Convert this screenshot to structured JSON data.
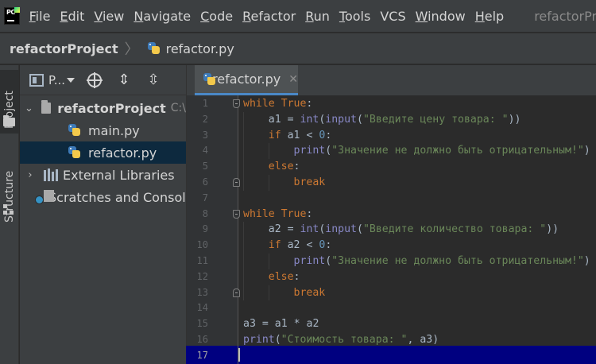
{
  "app": {
    "logo_text": "PC",
    "window_title": "refactorPro"
  },
  "menu": [
    {
      "label": "File",
      "mnemonic": "F",
      "rest": "ile"
    },
    {
      "label": "Edit",
      "mnemonic": "E",
      "rest": "dit"
    },
    {
      "label": "View",
      "mnemonic": "V",
      "rest": "iew"
    },
    {
      "label": "Navigate",
      "mnemonic": "N",
      "rest": "avigate"
    },
    {
      "label": "Code",
      "mnemonic": "C",
      "rest": "ode"
    },
    {
      "label": "Refactor",
      "mnemonic": "R",
      "rest": "efactor"
    },
    {
      "label": "Run",
      "mnemonic": "R",
      "rest": "un"
    },
    {
      "label": "Tools",
      "mnemonic": "T",
      "rest": "ools"
    },
    {
      "label": "VCS",
      "mnemonic": "",
      "rest": "VCS"
    },
    {
      "label": "Window",
      "mnemonic": "W",
      "rest": "indow"
    },
    {
      "label": "Help",
      "mnemonic": "H",
      "rest": "elp"
    }
  ],
  "breadcrumbs": {
    "project": "refactorProject",
    "file": "refactor.py"
  },
  "tool_stripe": {
    "project_tab": "Project",
    "structure_tab": "Structure"
  },
  "project_panel": {
    "view_label": "P...",
    "tree": {
      "root_name": "refactorProject",
      "root_path": "C:\\",
      "files": [
        "main.py",
        "refactor.py"
      ],
      "external_libraries": "External Libraries",
      "scratches": "Scratches and Consoles"
    }
  },
  "editor": {
    "tab_label": "refactor.py",
    "close_glyph": "✕",
    "current_line": 17,
    "lines": [
      {
        "n": "1",
        "code": "while True:"
      },
      {
        "n": "2",
        "code": "    a1 = int(input(\"Введите цену товара: \"))"
      },
      {
        "n": "3",
        "code": "    if a1 < 0:"
      },
      {
        "n": "4",
        "code": "        print(\"Значение не должно быть отрицательным!\")"
      },
      {
        "n": "5",
        "code": "    else:"
      },
      {
        "n": "6",
        "code": "        break"
      },
      {
        "n": "7",
        "code": ""
      },
      {
        "n": "8",
        "code": "while True:"
      },
      {
        "n": "9",
        "code": "    a2 = int(input(\"Введите количество товара: \"))"
      },
      {
        "n": "10",
        "code": "    if a2 < 0:"
      },
      {
        "n": "11",
        "code": "        print(\"Значение не должно быть отрицательным!\")"
      },
      {
        "n": "12",
        "code": "    else:"
      },
      {
        "n": "13",
        "code": "        break"
      },
      {
        "n": "14",
        "code": ""
      },
      {
        "n": "15",
        "code": "a3 = a1 * a2"
      },
      {
        "n": "16",
        "code": "print(\"Стоимость товара: \", a3)"
      },
      {
        "n": "17",
        "code": ""
      }
    ]
  },
  "colors": {
    "keyword": "#cc7832",
    "builtin": "#8888c6",
    "string": "#6a8759",
    "number": "#6897bb",
    "current_line": "#000080",
    "selection": "#0d293e"
  }
}
